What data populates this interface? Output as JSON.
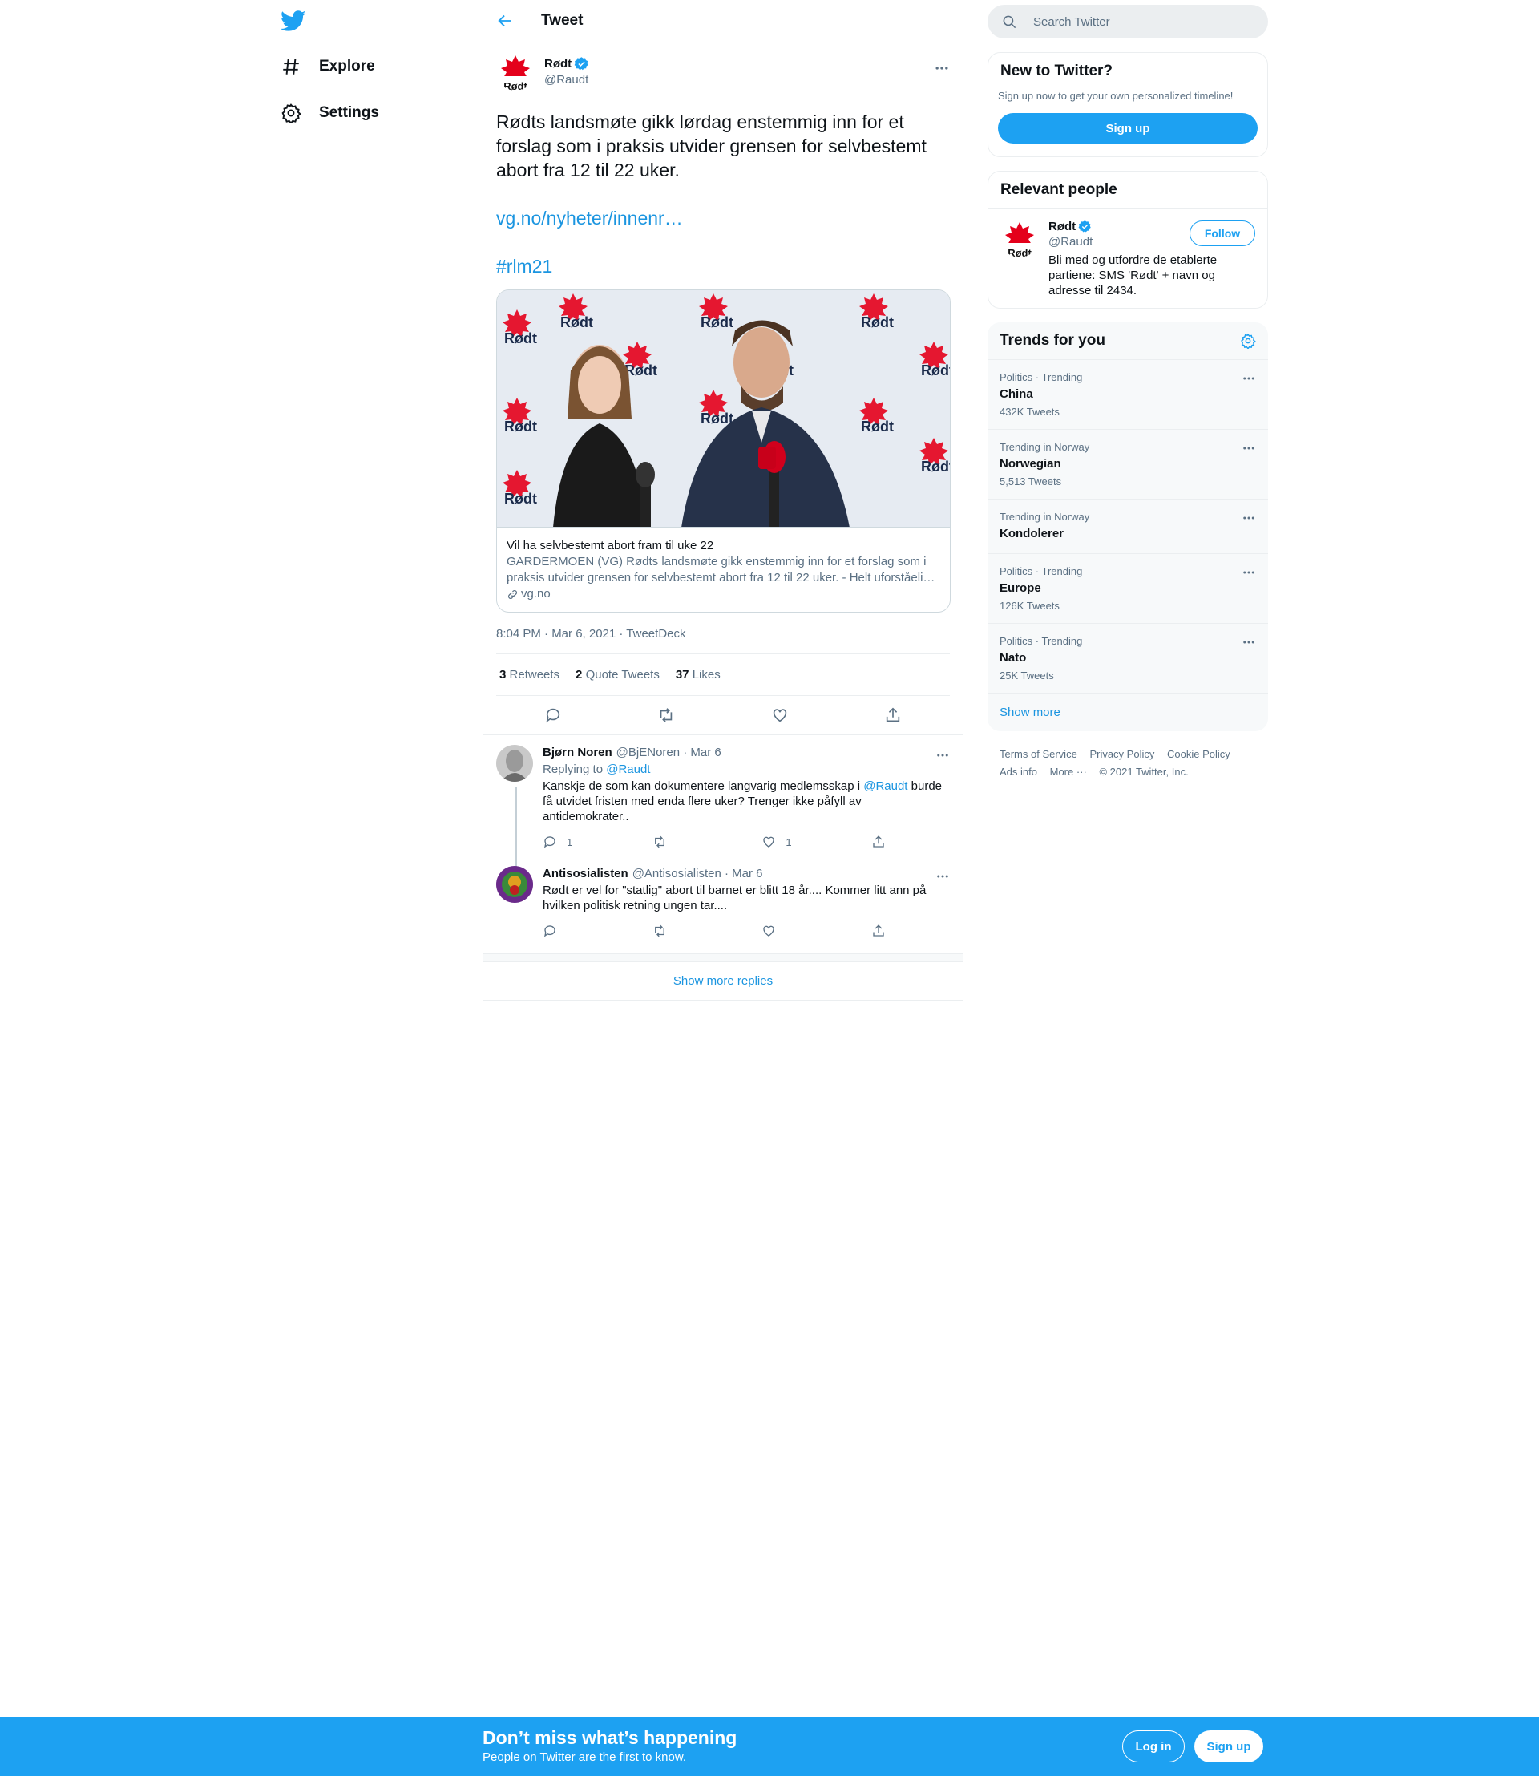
{
  "nav": {
    "items": [
      {
        "label": "Explore",
        "icon": "hashtag-icon"
      },
      {
        "label": "Settings",
        "icon": "gear-icon"
      }
    ]
  },
  "header": {
    "title": "Tweet"
  },
  "tweet": {
    "author_name": "Rødt",
    "author_handle": "@Raudt",
    "text_main": "Rødts landsmøte gikk lørdag enstemmig inn for et forslag som i praksis utvider grensen for selvbestemt abort fra 12 til 22 uker.",
    "link": "vg.no/nyheter/innenr…",
    "hashtag": "#rlm21",
    "card": {
      "title": "Vil ha selvbestemt abort fram til uke 22",
      "description": "GARDERMOEN (VG) Rødts landsmøte gikk enstemmig inn for et forslag som i praksis utvider grensen for selvbestemt abort fra 12 til 22 uker. - Helt uforståeli…",
      "domain": "vg.no",
      "backdrop_word": "Rødt"
    },
    "meta": "8:04 PM · Mar 6, 2021 · TweetDeck",
    "stats": [
      {
        "count": "3",
        "label": "Retweets"
      },
      {
        "count": "2",
        "label": "Quote Tweets"
      },
      {
        "count": "37",
        "label": "Likes"
      }
    ]
  },
  "replies": [
    {
      "name": "Bjørn Noren",
      "handle_date": "@BjENoren · Mar 6",
      "replying_label": "Replying to",
      "replying_to": "@Raudt",
      "text_before": "Kanskje de som kan dokumentere langvarig medlemsskap i",
      "mention": "@Raudt",
      "text_after": "burde få utvidet fristen med enda flere uker? Trenger ikke påfyll av antidemokrater..",
      "reply_count": "1",
      "retweet_count": "",
      "like_count": "1"
    },
    {
      "name": "Antisosialisten",
      "handle_date": "@Antisosialisten · Mar 6",
      "text": "Rødt er vel for \"statlig\" abort til barnet er blitt 18 år.... Kommer litt ann på hvilken politisk retning ungen tar....",
      "reply_count": "",
      "retweet_count": "",
      "like_count": ""
    }
  ],
  "show_more_replies": "Show more replies",
  "sidebar": {
    "search_placeholder": "Search Twitter",
    "new_title": "New to Twitter?",
    "new_text": "Sign up now to get your own personalized timeline!",
    "signup_label": "Sign up",
    "relevant_title": "Relevant people",
    "person": {
      "name": "Rødt",
      "handle": "@Raudt",
      "bio": "Bli med og utfordre de etablerte partiene: SMS 'Rødt' + navn og adresse til 2434.",
      "follow_label": "Follow"
    },
    "trends_title": "Trends for you",
    "trends": [
      {
        "context": "Politics · Trending",
        "name": "China",
        "count": "432K Tweets"
      },
      {
        "context": "Trending in Norway",
        "name": "Norwegian",
        "count": "5,513 Tweets"
      },
      {
        "context": "Trending in Norway",
        "name": "Kondolerer",
        "count": ""
      },
      {
        "context": "Politics · Trending",
        "name": "Europe",
        "count": "126K Tweets"
      },
      {
        "context": "Politics · Trending",
        "name": "Nato",
        "count": "25K Tweets"
      }
    ],
    "show_more": "Show more",
    "footer_links": [
      "Terms of Service",
      "Privacy Policy",
      "Cookie Policy",
      "Ads info",
      "More ···"
    ],
    "copyright": "© 2021 Twitter, Inc."
  },
  "bottom_bar": {
    "title": "Don’t miss what’s happening",
    "subtitle": "People on Twitter are the first to know.",
    "login_label": "Log in",
    "signup_label": "Sign up"
  },
  "colors": {
    "accent": "#1da1f2",
    "link": "#1b95e0",
    "muted": "#5b7083",
    "brand_red": "#e4001b"
  }
}
